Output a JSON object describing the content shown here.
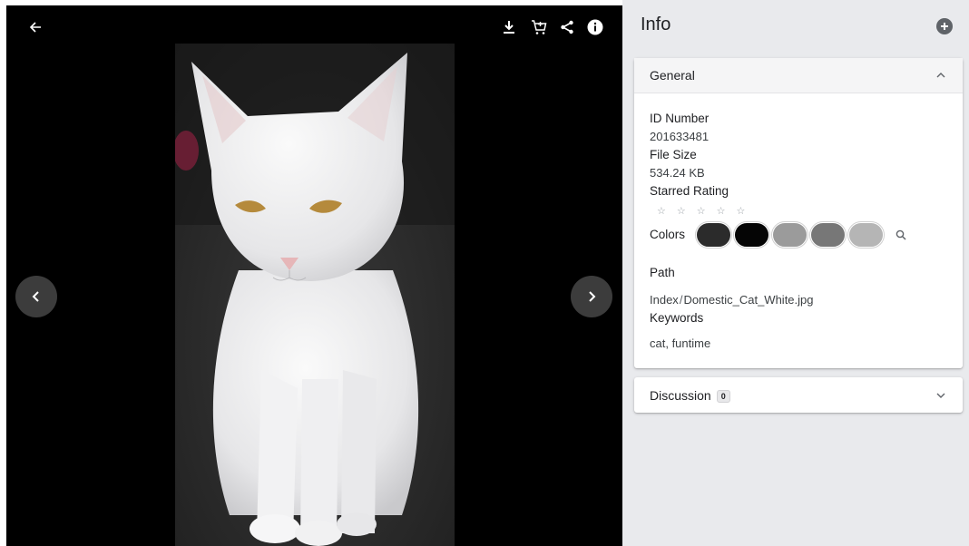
{
  "viewer": {
    "back_icon": "arrow-left-icon",
    "toolbar_icons": [
      "download-icon",
      "cart-icon",
      "share-icon",
      "info-icon"
    ],
    "prev_icon": "chevron-left-icon",
    "next_icon": "chevron-right-icon"
  },
  "panel": {
    "title": "Info",
    "add_icon": "plus-circle-icon"
  },
  "general": {
    "title": "General",
    "id_label": "ID Number",
    "id_value": "201633481",
    "size_label": "File Size",
    "size_value": "534.24 KB",
    "rating_label": "Starred Rating",
    "rating": 0,
    "stars": [
      "☆",
      "☆",
      "☆",
      "☆",
      "☆"
    ],
    "colors_label": "Colors",
    "colors": [
      "#2b2b2b",
      "#050505",
      "#9b9b9b",
      "#777777",
      "#b5b5b5"
    ],
    "path_label": "Path",
    "path_parts": [
      "Index",
      "Domestic_Cat_White.jpg"
    ],
    "path_separator": "/",
    "keywords_label": "Keywords",
    "keywords_value": "cat, funtime"
  },
  "discussion": {
    "title": "Discussion",
    "count": "0"
  }
}
